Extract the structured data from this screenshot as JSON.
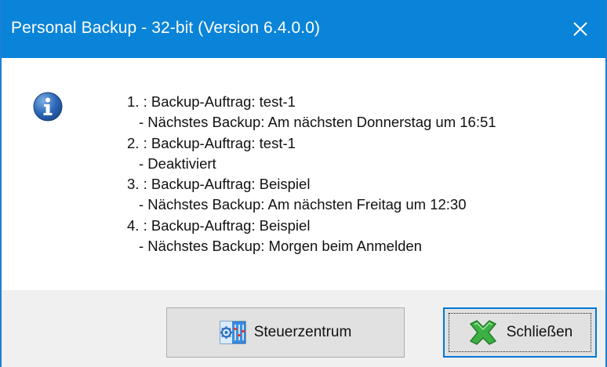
{
  "window": {
    "title": "Personal Backup - 32-bit (Version 6.4.0.0)",
    "titlebar_color": "#0a84d8",
    "close_icon": "close-icon"
  },
  "message": {
    "icon": "info-icon",
    "lines": [
      "1. : Backup-Auftrag: test-1",
      "- Nächstes Backup: Am nächsten Donnerstag um 16:51",
      "2. : Backup-Auftrag: test-1",
      "- Deaktiviert",
      "3. : Backup-Auftrag: Beispiel",
      "- Nächstes Backup: Am nächsten Freitag um 12:30",
      "4. : Backup-Auftrag: Beispiel",
      "- Nächstes Backup: Morgen beim Anmelden"
    ]
  },
  "buttons": {
    "steuerzentrum": {
      "label": "Steuerzentrum",
      "icon": "control-center-icon"
    },
    "schliessen": {
      "label": "Schließen",
      "icon": "green-x-icon",
      "focused": true
    }
  }
}
